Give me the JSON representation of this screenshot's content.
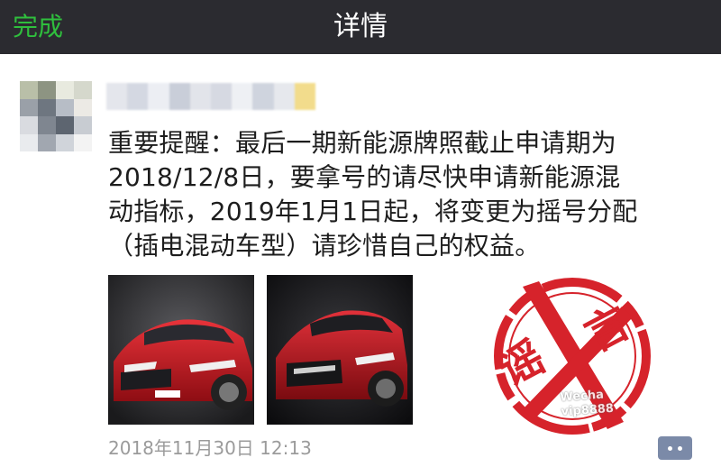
{
  "navbar": {
    "done_label": "完成",
    "title": "详情"
  },
  "post": {
    "message_lines": [
      "重要提醒：最后一期新能源牌照截止申请期为",
      "2018/12/8日，要拿号的请尽快申请新能源混",
      "动指标，2019年1月1日起，将变更为摇号分配",
      "（插电混动车型）请珍惜自己的权益。"
    ],
    "timestamp": "2018年11月30日 12:13"
  },
  "stamp": {
    "text_1": "谣",
    "text_2": "言",
    "color": "#d6232b"
  },
  "watermark": {
    "line_1": "Wecha",
    "line_2": "vip8888"
  },
  "colors": {
    "navbar_bg": "#2b2b30",
    "done_green": "#2fbf3d",
    "car_red": "#c4141d",
    "comment_button": "#7b8aa8"
  }
}
